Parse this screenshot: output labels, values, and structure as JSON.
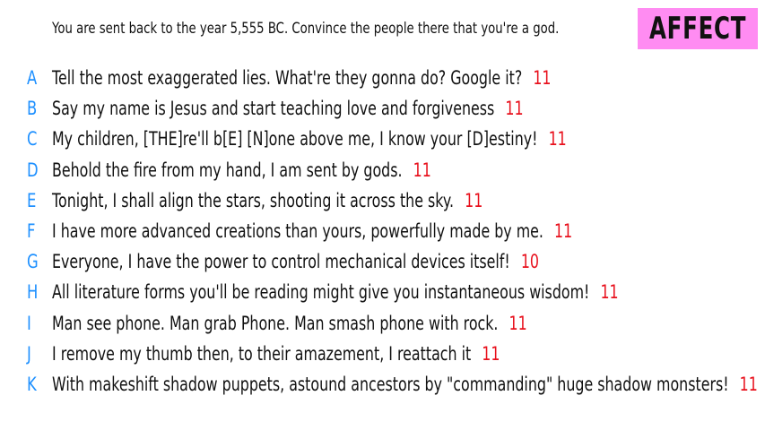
{
  "prompt": "You are sent back to the year 5,555 BC. Convince the people there that you're a god.",
  "badge": "AFFECT",
  "colors": {
    "badge_bg": "#ff8cf2",
    "letter": "#1e90ff",
    "score": "#e8101c"
  },
  "answers": [
    {
      "letter": "A",
      "text": "Tell the most exaggerated lies. What're they gonna do? Google it?",
      "score": "11"
    },
    {
      "letter": "B",
      "text": "Say my name is Jesus and start teaching love and forgiveness",
      "score": "11"
    },
    {
      "letter": "C",
      "text": "My children, [THE]re'll b[E] [N]one above me, I know your [D]estiny!",
      "score": "11"
    },
    {
      "letter": "D",
      "text": "Behold the fire from my hand, I am sent by gods.",
      "score": "11"
    },
    {
      "letter": "E",
      "text": "Tonight, I shall align the stars, shooting it across the sky.",
      "score": "11"
    },
    {
      "letter": "F",
      "text": "I have more advanced creations than yours, powerfully made by me.",
      "score": "11"
    },
    {
      "letter": "G",
      "text": "Everyone, I have the power to control mechanical devices itself!",
      "score": "10"
    },
    {
      "letter": "H",
      "text": "All literature forms you'll be reading might give you instantaneous wisdom!",
      "score": "11"
    },
    {
      "letter": "I",
      "text": "Man see phone. Man grab Phone. Man smash phone with rock.",
      "score": "11"
    },
    {
      "letter": "J",
      "text": "I remove my thumb then, to their amazement, I reattach it",
      "score": "11"
    },
    {
      "letter": "K",
      "text": "With makeshift shadow puppets, astound ancestors by \"commanding\" huge shadow monsters!",
      "score": "11"
    }
  ]
}
